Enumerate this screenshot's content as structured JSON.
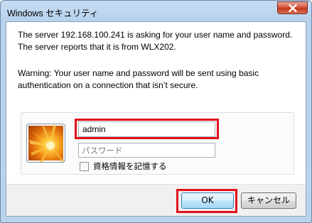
{
  "window": {
    "title": "Windows セキュリティ"
  },
  "dialog": {
    "message": "The server 192.168.100.241 is asking for your user name and password. The server reports that it is from WLX202.",
    "warning": "Warning: Your user name and password will be sent using basic authentication on a connection that isn’t secure."
  },
  "credentials": {
    "username_value": "admin",
    "password_placeholder": "パスワード",
    "remember_label": "資格情報を記憶する",
    "remember_checked": false
  },
  "buttons": {
    "ok_label": "OK",
    "cancel_label": "キャンセル"
  },
  "colors": {
    "highlight": "#e0101c",
    "titlebar": "#c6dcf2",
    "close_button": "#c23a20"
  },
  "icons": {
    "close": "close-icon",
    "avatar": "user-avatar-flower"
  }
}
